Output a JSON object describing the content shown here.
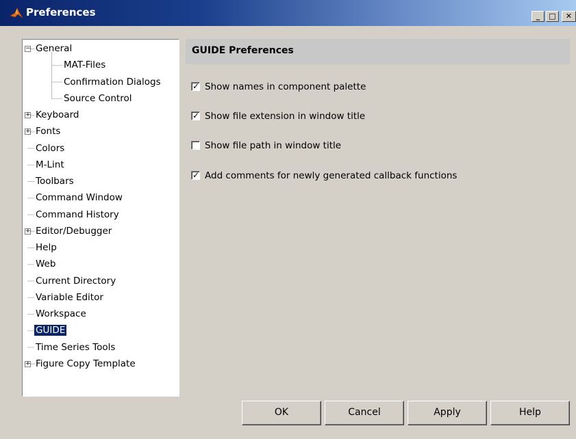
{
  "window": {
    "title": "Preferences",
    "controls": {
      "minimize": "_",
      "maximize": "□",
      "close": "✕"
    }
  },
  "tree": {
    "items": [
      {
        "label": "General",
        "depth": 0,
        "expander": "−"
      },
      {
        "label": "MAT-Files",
        "depth": 1
      },
      {
        "label": "Confirmation Dialogs",
        "depth": 1
      },
      {
        "label": "Source Control",
        "depth": 1
      },
      {
        "label": "Keyboard",
        "depth": 0,
        "expander": "+"
      },
      {
        "label": "Fonts",
        "depth": 0,
        "expander": "+"
      },
      {
        "label": "Colors",
        "depth": 0
      },
      {
        "label": "M-Lint",
        "depth": 0
      },
      {
        "label": "Toolbars",
        "depth": 0
      },
      {
        "label": "Command Window",
        "depth": 0
      },
      {
        "label": "Command History",
        "depth": 0
      },
      {
        "label": "Editor/Debugger",
        "depth": 0,
        "expander": "+"
      },
      {
        "label": "Help",
        "depth": 0
      },
      {
        "label": "Web",
        "depth": 0
      },
      {
        "label": "Current Directory",
        "depth": 0
      },
      {
        "label": "Variable Editor",
        "depth": 0
      },
      {
        "label": "Workspace",
        "depth": 0
      },
      {
        "label": "GUIDE",
        "depth": 0,
        "selected": true
      },
      {
        "label": "Time Series Tools",
        "depth": 0
      },
      {
        "label": "Figure Copy Template",
        "depth": 0,
        "expander": "+"
      }
    ]
  },
  "panel": {
    "title": "GUIDE Preferences",
    "options": [
      {
        "label": "Show names in component palette",
        "checked": true
      },
      {
        "label": "Show file extension in window title",
        "checked": true
      },
      {
        "label": "Show file path in window title",
        "checked": false
      },
      {
        "label": "Add comments for newly generated callback functions",
        "checked": true
      }
    ]
  },
  "buttons": {
    "ok": "OK",
    "cancel": "Cancel",
    "apply": "Apply",
    "help": "Help"
  },
  "colors": {
    "title_start": "#0a246a",
    "title_end": "#a6caf0",
    "selection": "#0a246a",
    "face": "#d4d0c8"
  },
  "icons": {
    "app": "matlab-logo-icon",
    "check": "checkmark-icon"
  }
}
